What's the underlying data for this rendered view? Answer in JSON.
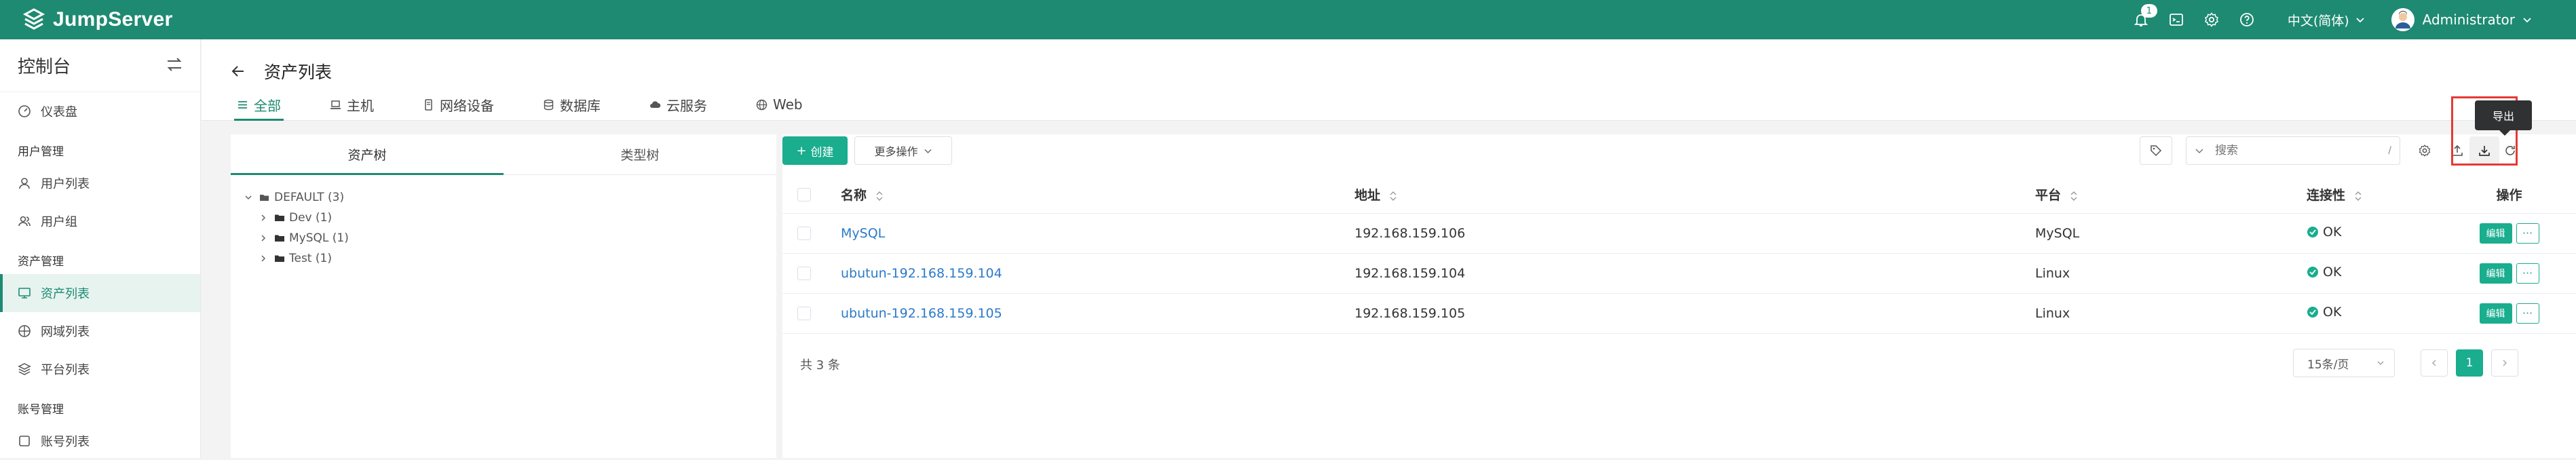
{
  "app": {
    "name": "JumpServer"
  },
  "topbar": {
    "notification_count": "1",
    "language": "中文(简体)",
    "user_name": "Administrator",
    "icons": [
      "bell-icon",
      "terminal-icon",
      "settings-icon",
      "help-icon"
    ]
  },
  "sidebar": {
    "title": "控制台",
    "dashboard": "仪表盘",
    "groups": {
      "user_mgmt": "用户管理",
      "asset_mgmt": "资产管理",
      "account_mgmt": "账号管理"
    },
    "items": {
      "user_list": "用户列表",
      "user_group": "用户组",
      "asset_list": "资产列表",
      "domain_list": "网域列表",
      "platform_list": "平台列表",
      "account_list": "账号列表"
    }
  },
  "page": {
    "title": "资产列表",
    "tabs": [
      "全部",
      "主机",
      "网络设备",
      "数据库",
      "云服务",
      "Web"
    ]
  },
  "tree": {
    "tabs": [
      "资产树",
      "类型树"
    ],
    "root": "DEFAULT (3)",
    "children": [
      "Dev (1)",
      "MySQL (1)",
      "Test (1)"
    ]
  },
  "toolbar": {
    "create_label": "创建",
    "more_label": "更多操作",
    "search_placeholder": "搜索",
    "search_shortcut": "/",
    "export_tooltip": "导出"
  },
  "table": {
    "headers": {
      "name": "名称",
      "address": "地址",
      "platform": "平台",
      "connectivity": "连接性",
      "actions": "操作"
    },
    "rows": [
      {
        "name": "MySQL",
        "address": "192.168.159.106",
        "platform": "MySQL",
        "connectivity": "OK"
      },
      {
        "name": "ubutun-192.168.159.104",
        "address": "192.168.159.104",
        "platform": "Linux",
        "connectivity": "OK"
      },
      {
        "name": "ubutun-192.168.159.105",
        "address": "192.168.159.105",
        "platform": "Linux",
        "connectivity": "OK"
      }
    ],
    "edit_label": "编辑",
    "more_label": "···"
  },
  "pagination": {
    "total_text": "共 3 条",
    "page_size": "15条/页",
    "current_page": "1"
  },
  "colors": {
    "brand": "#1e8a71",
    "primary_button": "#1aad8e",
    "link": "#2a7ac8",
    "highlight_frame": "#e53935"
  }
}
